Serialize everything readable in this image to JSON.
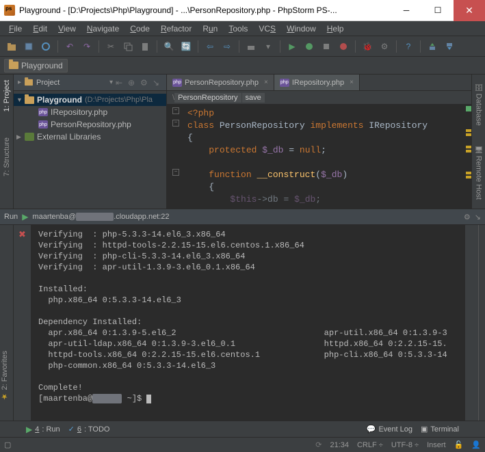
{
  "window": {
    "title": "Playground - [D:\\Projects\\Php\\Playground] - ...\\PersonRepository.php - PhpStorm PS-..."
  },
  "menu": [
    "File",
    "Edit",
    "View",
    "Navigate",
    "Code",
    "Refactor",
    "Run",
    "Tools",
    "VCS",
    "Window",
    "Help"
  ],
  "breadcrumb": "Playground",
  "left_tools": [
    {
      "label": "1: Project",
      "active": true
    },
    {
      "label": "7: Structure",
      "active": false
    }
  ],
  "right_tools": [
    "Database",
    "Remote Host"
  ],
  "project_panel": {
    "title": "Project",
    "root": {
      "name": "Playground",
      "path": "(D:\\Projects\\Php\\Pla"
    },
    "files": [
      "IRepository.php",
      "PersonRepository.php"
    ],
    "libs": "External Libraries"
  },
  "tabs": [
    {
      "label": "PersonRepository.php",
      "active": true
    },
    {
      "label": "IRepository.php",
      "active": false
    }
  ],
  "crumbs": [
    "PersonRepository",
    "save"
  ],
  "code": {
    "l1": "<?php",
    "l2a": "class",
    "l2b": "PersonRepository",
    "l2c": "implements",
    "l2d": "IRepository",
    "l3": "{",
    "l4a": "protected",
    "l4b": "$_db",
    "l4c": "=",
    "l4d": "null",
    "l4e": ";",
    "l5a": "function",
    "l5b": "__construct",
    "l5c": "(",
    "l5d": "$_db",
    "l5e": ")",
    "l6": "{",
    "l7a": "$this",
    "l7b": "->",
    "l7c": "db",
    "l7d": "=",
    "l7e": "$_db",
    "l7f": ";"
  },
  "run": {
    "title_prefix": "Run",
    "host_prefix": "maartenba@",
    "host_suffix": ".cloudapp.net:22",
    "lines": [
      "Verifying  : php-5.3.3-14.el6_3.x86_64",
      "Verifying  : httpd-tools-2.2.15-15.el6.centos.1.x86_64",
      "Verifying  : php-cli-5.3.3-14.el6_3.x86_64",
      "Verifying  : apr-util-1.3.9-3.el6_0.1.x86_64",
      "",
      "Installed:",
      "  php.x86_64 0:5.3.3-14.el6_3",
      "",
      "Dependency Installed:",
      "  apr.x86_64 0:1.3.9-5.el6_2                              apr-util.x86_64 0:1.3.9-3",
      "  apr-util-ldap.x86_64 0:1.3.9-3.el6_0.1                  httpd.x86_64 0:2.2.15-15.",
      "  httpd-tools.x86_64 0:2.2.15-15.el6.centos.1             php-cli.x86_64 0:5.3.3-14",
      "  php-common.x86_64 0:5.3.3-14.el6_3",
      "",
      "Complete!"
    ],
    "prompt_user": "[maartenba@",
    "prompt_suffix": " ~]$ "
  },
  "bottom_tabs": {
    "run": "4: Run",
    "todo": "6: TODO",
    "eventlog": "Event Log",
    "terminal": "Terminal"
  },
  "status": {
    "col": "21:34",
    "eol": "CRLF",
    "enc": "UTF-8",
    "mode": "Insert"
  }
}
